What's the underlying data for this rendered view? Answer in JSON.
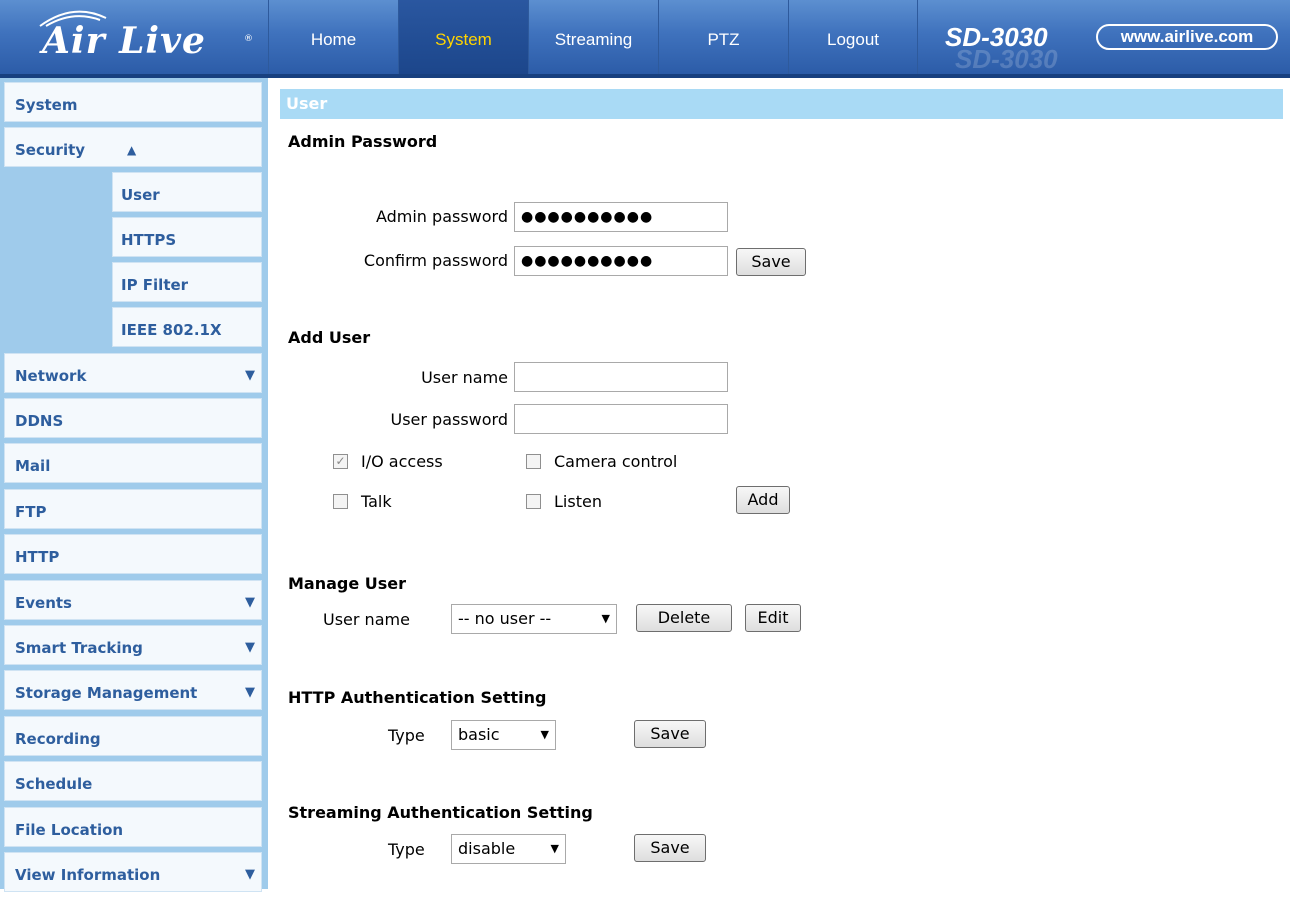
{
  "brand": {
    "logo_text": "Air Live",
    "model": "SD-3030",
    "url": "www.airlive.com"
  },
  "nav": {
    "tabs": [
      {
        "label": "Home"
      },
      {
        "label": "System",
        "active": true
      },
      {
        "label": "Streaming"
      },
      {
        "label": "PTZ"
      },
      {
        "label": "Logout"
      }
    ]
  },
  "sidebar": {
    "items": [
      {
        "label": "System"
      },
      {
        "label": "Security",
        "expanded": true
      },
      {
        "label": "Network",
        "has_submenu": true
      },
      {
        "label": "DDNS"
      },
      {
        "label": "Mail"
      },
      {
        "label": "FTP"
      },
      {
        "label": "HTTP"
      },
      {
        "label": "Events",
        "has_submenu": true
      },
      {
        "label": "Smart Tracking",
        "has_submenu": true
      },
      {
        "label": "Storage Management",
        "has_submenu": true
      },
      {
        "label": "Recording"
      },
      {
        "label": "Schedule"
      },
      {
        "label": "File Location"
      },
      {
        "label": "View Information",
        "has_submenu": true
      }
    ],
    "security_sub": [
      {
        "label": "User",
        "selected": true
      },
      {
        "label": "HTTPS"
      },
      {
        "label": "IP Filter"
      },
      {
        "label": "IEEE 802.1X"
      }
    ]
  },
  "page": {
    "title": "User",
    "admin": {
      "heading": "Admin Password",
      "password_label": "Admin password",
      "password_value": "●●●●●●●●●●",
      "confirm_label": "Confirm password",
      "confirm_value": "●●●●●●●●●●",
      "save_label": "Save"
    },
    "add_user": {
      "heading": "Add User",
      "username_label": "User name",
      "username_value": "",
      "password_label": "User password",
      "password_value": "",
      "io_access_label": "I/O access",
      "io_access_checked": true,
      "camera_control_label": "Camera control",
      "camera_control_checked": false,
      "talk_label": "Talk",
      "talk_checked": false,
      "listen_label": "Listen",
      "listen_checked": false,
      "add_label": "Add"
    },
    "manage_user": {
      "heading": "Manage User",
      "username_label": "User name",
      "selected": "-- no user --",
      "delete_label": "Delete",
      "edit_label": "Edit"
    },
    "http_auth": {
      "heading": "HTTP Authentication Setting",
      "type_label": "Type",
      "type_value": "basic",
      "save_label": "Save"
    },
    "stream_auth": {
      "heading": "Streaming Authentication Setting",
      "type_label": "Type",
      "type_value": "disable",
      "save_label": "Save"
    }
  },
  "colors": {
    "banner": "#3f72bd",
    "active_tab_text": "#ffd400",
    "sidebar_bg": "#9fcbeb",
    "sidebar_text": "#2e5e9e",
    "header_bar": "#a9daf5"
  }
}
